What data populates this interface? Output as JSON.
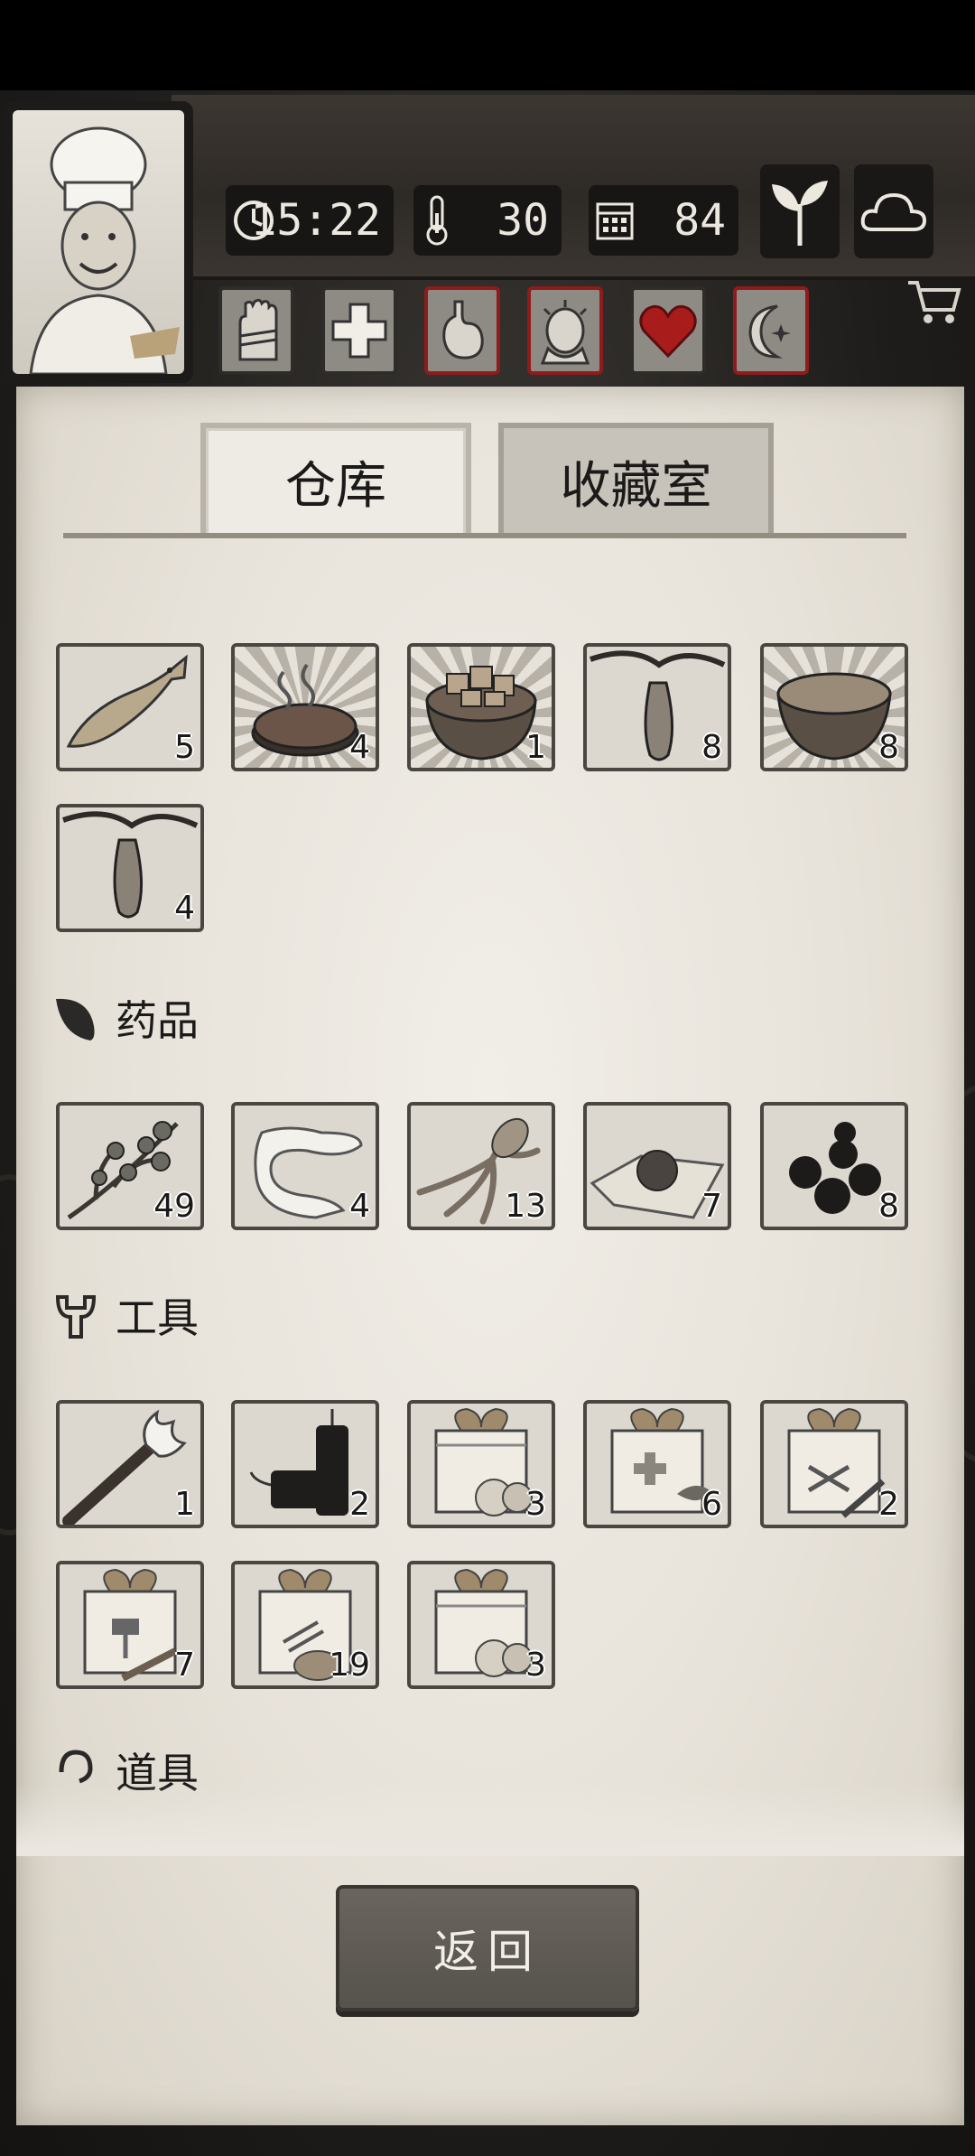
{
  "hud": {
    "time": "15:22",
    "temperature": "30",
    "day": "84"
  },
  "tabs": {
    "warehouse": "仓库",
    "collection": "收藏室"
  },
  "food_items": [
    {
      "icon": "fish-icon",
      "count": "5"
    },
    {
      "icon": "grilled-steak-icon",
      "count": "4"
    },
    {
      "icon": "meat-bowl-icon",
      "count": "1"
    },
    {
      "icon": "hanging-pod-icon",
      "count": "8"
    },
    {
      "icon": "soup-bowl-icon",
      "count": "8"
    },
    {
      "icon": "hanging-pod-icon",
      "count": "4"
    }
  ],
  "sections": {
    "medicine": "药品",
    "tools": "工具",
    "props": "道具"
  },
  "medicine_items": [
    {
      "icon": "herb-branch-icon",
      "count": "49"
    },
    {
      "icon": "bandage-icon",
      "count": "4"
    },
    {
      "icon": "ginseng-root-icon",
      "count": "13"
    },
    {
      "icon": "pill-on-paper-icon",
      "count": "7"
    },
    {
      "icon": "berries-icon",
      "count": "8"
    }
  ],
  "tool_items": [
    {
      "icon": "torch-icon",
      "count": "1"
    },
    {
      "icon": "dynamite-icon",
      "count": "2"
    },
    {
      "icon": "food-crate-icon",
      "count": "3"
    },
    {
      "icon": "medical-crate-icon",
      "count": "6"
    },
    {
      "icon": "tool-crate-icon",
      "count": "2"
    },
    {
      "icon": "hammer-crate-icon",
      "count": "7"
    },
    {
      "icon": "wood-crate-icon",
      "count": "19"
    },
    {
      "icon": "food-crate-icon",
      "count": "3"
    }
  ],
  "back_button": "返回"
}
